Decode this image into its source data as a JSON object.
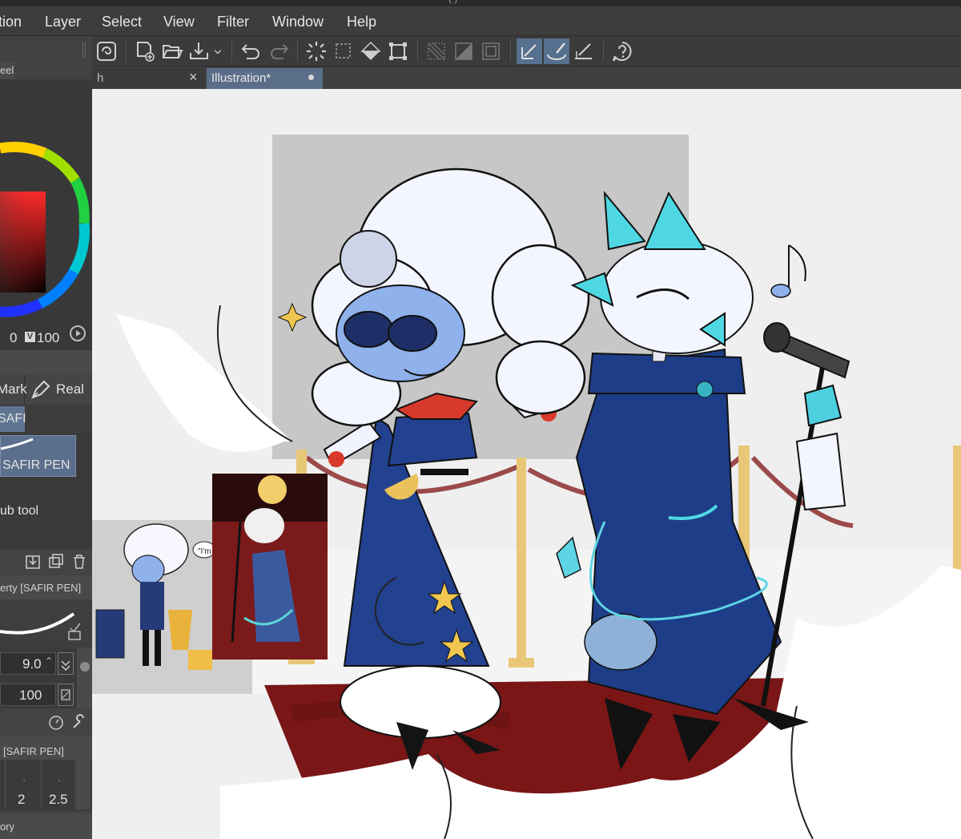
{
  "window": {
    "title_fragment": "(                                    )"
  },
  "menu": [
    "tion",
    "Layer",
    "Select",
    "View",
    "Filter",
    "Window",
    "Help"
  ],
  "tabs": {
    "tab1_label": "h",
    "tab1_close": "×",
    "tab2_label": "Illustration*"
  },
  "left_panel": {
    "color_tab": "eel",
    "color_values": {
      "h": "0",
      "v_badge": "V",
      "v": "100"
    },
    "subtool_tabs": [
      "Mark",
      "Real"
    ],
    "pen_group": "SAFI",
    "pen_name": "SAFIR PEN",
    "sub_tool_label": "ub tool",
    "property_title": "erty [SAFIR PEN]",
    "brush_size": "9.0",
    "opacity": "100",
    "detail_title": "[SAFIR PEN]",
    "size_presets": [
      "2",
      "2.5"
    ],
    "history_label": "ory"
  },
  "toolbar": {
    "icons": [
      "app-logo-icon",
      "new-canvas-icon",
      "open-folder-icon",
      "save-icon",
      "save-dropdown-icon",
      "undo-icon",
      "redo-icon",
      "loading-spinner-icon",
      "selection-icon",
      "fill-icon",
      "transform-icon",
      "select-all-icon",
      "invert-selection-icon",
      "deselect-icon",
      "vector-pen-icon",
      "brush-icon",
      "ruler-icon",
      "help-icon"
    ]
  },
  "canvas": {
    "reference_bubble_text": "\"I'm"
  }
}
